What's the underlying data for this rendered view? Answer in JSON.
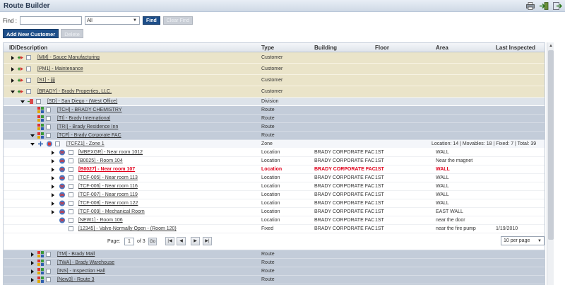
{
  "window": {
    "title": "Route Builder"
  },
  "icons": {
    "print": "printer-icon",
    "export": "export-arrow-icon",
    "exit": "exit-icon"
  },
  "find": {
    "label": "Find :",
    "value": "",
    "filter": "All",
    "find_button": "Find",
    "clear_button": "Clear Find"
  },
  "actions": {
    "add_customer": "Add New Customer",
    "delete": "Delete"
  },
  "columns": {
    "id": "ID/Description",
    "type": "Type",
    "building": "Building",
    "floor": "Floor",
    "area": "Area",
    "inspected": "Last Inspected"
  },
  "rows": [
    {
      "id": "[MM] - Sauce Manufacturing",
      "type": "Customer",
      "building": "",
      "floor": "",
      "area": "",
      "inspected": ""
    },
    {
      "id": "[PM1] - Maintenance",
      "type": "Customer",
      "building": "",
      "floor": "",
      "area": "",
      "inspected": ""
    },
    {
      "id": "[S1] - jjjj",
      "type": "Customer",
      "building": "",
      "floor": "",
      "area": "",
      "inspected": ""
    },
    {
      "id": "[BRADY] - Brady Properties, LLC.",
      "type": "Customer",
      "building": "",
      "floor": "",
      "area": "",
      "inspected": ""
    },
    {
      "id": "[SD] - San Diego - (West Office)",
      "type": "Division",
      "building": "",
      "floor": "",
      "area": "",
      "inspected": ""
    },
    {
      "id": "[TCH] - BRADY CHEMISTRY",
      "type": "Route",
      "building": "",
      "floor": "",
      "area": "",
      "inspected": ""
    },
    {
      "id": "[TI] - Brady International",
      "type": "Route",
      "building": "",
      "floor": "",
      "area": "",
      "inspected": ""
    },
    {
      "id": "[TRI] - Brady Residence Inn",
      "type": "Route",
      "building": "",
      "floor": "",
      "area": "",
      "inspected": ""
    },
    {
      "id": "[TCF] - Brady Corporate FAC",
      "type": "Route",
      "building": "",
      "floor": "",
      "area": "",
      "inspected": ""
    },
    {
      "id": "[TCFZ1] - Zone 1",
      "type": "Zone",
      "building": "",
      "floor": "",
      "area": "",
      "inspected": "",
      "summary": "Location: 14 | Movables: 18 | Fixed: 7 | Total: 39"
    },
    {
      "id": "[MBEXGR] - Near room 1012",
      "type": "Location",
      "building": "BRADY CORPORATE FAC",
      "floor": "1ST",
      "area": "WALL",
      "inspected": ""
    },
    {
      "id": "[B0025] - Room 104",
      "type": "Location",
      "building": "BRADY CORPORATE FAC",
      "floor": "1ST",
      "area": "Near the magnet",
      "inspected": ""
    },
    {
      "id": "[B0027] - Near room 107",
      "type": "Location",
      "building": "BRADY CORPORATE FAC",
      "floor": "1ST",
      "area": "WALL",
      "inspected": ""
    },
    {
      "id": "[TCF-005] - Near room 113",
      "type": "Location",
      "building": "BRADY CORPORATE FAC",
      "floor": "1ST",
      "area": "WALL",
      "inspected": ""
    },
    {
      "id": "[TCF-006] - Near room 116",
      "type": "Location",
      "building": "BRADY CORPORATE FAC",
      "floor": "1ST",
      "area": "WALL",
      "inspected": ""
    },
    {
      "id": "[TCF-007] - Near room 119",
      "type": "Location",
      "building": "BRADY CORPORATE FAC",
      "floor": "1ST",
      "area": "WALL",
      "inspected": ""
    },
    {
      "id": "[TCF-008] - Near room 122",
      "type": "Location",
      "building": "BRADY CORPORATE FAC",
      "floor": "1ST",
      "area": "WALL",
      "inspected": ""
    },
    {
      "id": "[TCF-009] - Mechanical Room",
      "type": "Location",
      "building": "BRADY CORPORATE FAC",
      "floor": "1ST",
      "area": "EAST WALL",
      "inspected": ""
    },
    {
      "id": "[NEW1] - Room 106",
      "type": "Location",
      "building": "BRADY CORPORATE FAC",
      "floor": "1ST",
      "area": "near the door",
      "inspected": ""
    },
    {
      "id": "[12345] - Valve-Normally Open - (Room 120)",
      "type": "Fixed",
      "building": "BRADY CORPORATE FAC",
      "floor": "1ST",
      "area": "near the fire pump",
      "inspected": "1/19/2010"
    },
    {
      "id": "[TM] - Brady Mall",
      "type": "Route",
      "building": "",
      "floor": "",
      "area": "",
      "inspected": ""
    },
    {
      "id": "[TWA] - Brady Warehouse",
      "type": "Route",
      "building": "",
      "floor": "",
      "area": "",
      "inspected": ""
    },
    {
      "id": "[INS] - Inspection Hall",
      "type": "Route",
      "building": "",
      "floor": "",
      "area": "",
      "inspected": ""
    },
    {
      "id": "[New3] - Route 3",
      "type": "Route",
      "building": "",
      "floor": "",
      "area": "",
      "inspected": ""
    }
  ],
  "pager": {
    "page_label": "Page:",
    "page": "1",
    "of_label": "of 3",
    "go": "Go",
    "first": "|◀",
    "prev": "◀",
    "next": "▶",
    "last": "▶|",
    "per_page": "10 per page"
  },
  "colors": {
    "header_blue": "#1e4f8a",
    "highlight_red": "#e0001b",
    "customer_row": "#eae4c9",
    "route_row": "#c3ccd9"
  }
}
